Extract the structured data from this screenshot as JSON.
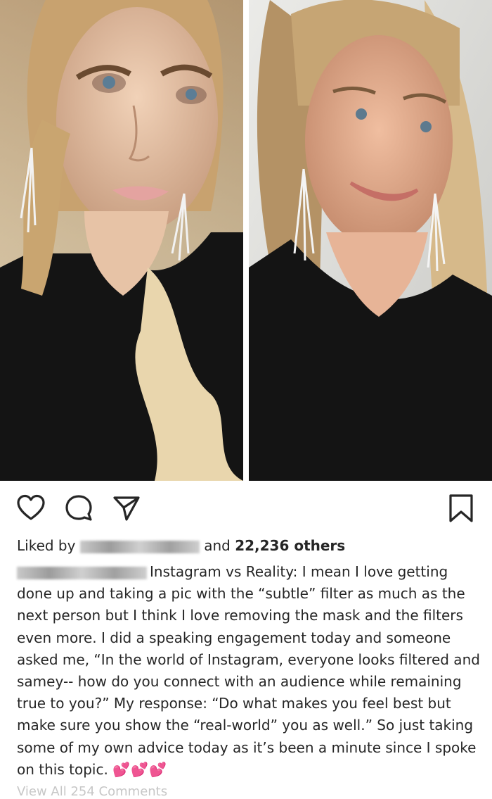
{
  "post": {
    "likes_prefix": "Liked by",
    "likes_suffix_and": "and",
    "likes_count_text": "22,236 others",
    "caption": "Instagram vs Reality: I mean I love getting done up and taking a pic with the “subtle” filter as much as the next person but I think I love removing the mask and the filters even more. I did a speaking engagement today and someone asked me, “In the world of Instagram, everyone looks filtered and samey-- how do you connect with an audience while remaining true to you?” My response: “Do what makes you feel best but make sure you show the “real-world” you as well.” So just taking some of my own advice today as it’s been a minute since I spoke on this topic.",
    "caption_emoji": "💕💕💕",
    "view_comments_partial": "View All 254 Comments"
  },
  "icons": {
    "like": "heart-icon",
    "comment": "comment-icon",
    "share": "send-icon",
    "save": "bookmark-icon"
  },
  "colors": {
    "text": "#262626",
    "background": "#ffffff",
    "heart_emoji": "#e0245e"
  }
}
